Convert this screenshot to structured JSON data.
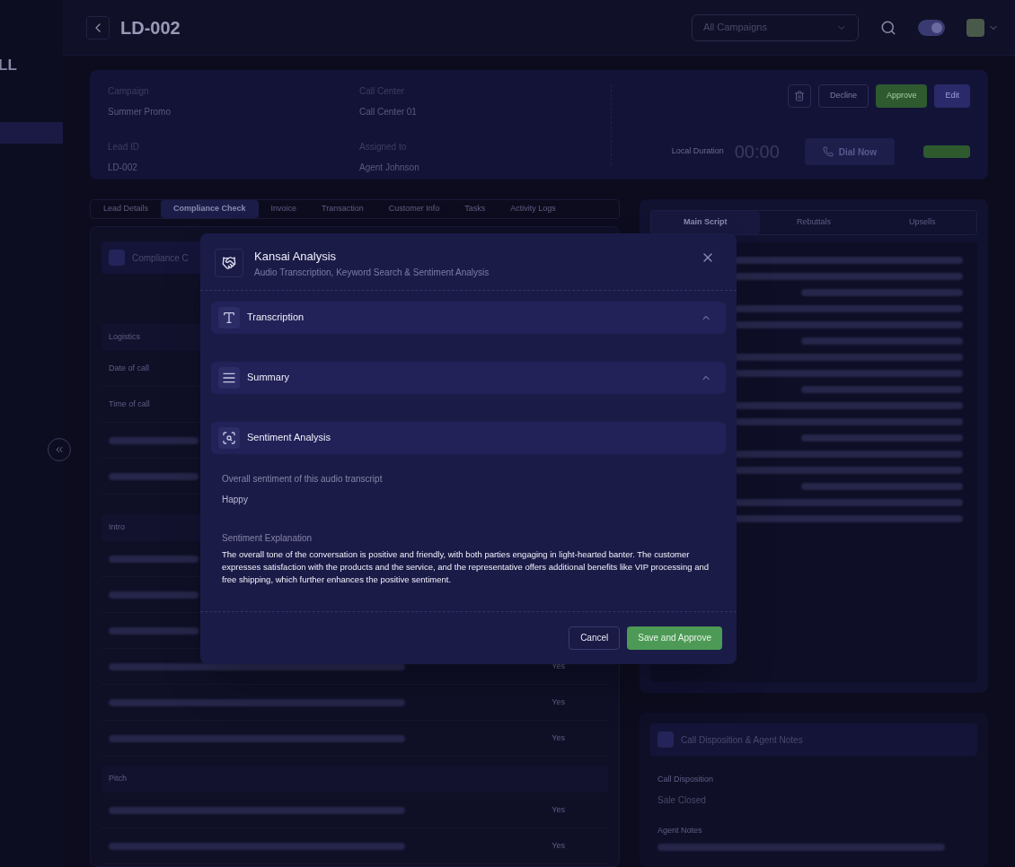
{
  "sidebar": {
    "logo_text": "LL"
  },
  "header": {
    "title": "LD-002",
    "campaign_select": {
      "value": "All Campaigns"
    },
    "theme_toggle": {
      "on": true
    }
  },
  "lead_card": {
    "fields": [
      {
        "label": "Campaign",
        "value": "Summer Promo"
      },
      {
        "label": "Call Center",
        "value": "Call Center 01"
      },
      {
        "label": "Lead ID",
        "value": "LD-002"
      },
      {
        "label": "Assigned to",
        "value": "Agent Johnson"
      }
    ],
    "actions": [
      {
        "label": "Decline",
        "kind": "outline"
      },
      {
        "label": "Approve",
        "kind": "success"
      },
      {
        "label": "Edit",
        "kind": "primary"
      }
    ],
    "duration_label": "Local Duration",
    "duration": "00:00",
    "dial_button": "Dial Now"
  },
  "tabs": [
    {
      "label": "Lead Details",
      "selected": false
    },
    {
      "label": "Compliance Check",
      "selected": true
    },
    {
      "label": "Invoice",
      "selected": false
    },
    {
      "label": "Transaction",
      "selected": false
    },
    {
      "label": "Customer Info",
      "selected": false
    },
    {
      "label": "Tasks",
      "selected": false
    },
    {
      "label": "Activity Logs",
      "selected": false
    }
  ],
  "compliance": {
    "title": "Compliance C",
    "sections": [
      {
        "title": "Logistics",
        "rows": [
          {
            "question": "Date of call"
          },
          {
            "question": "Time of call"
          },
          {
            "kind": "blurred"
          },
          {
            "kind": "blurred"
          }
        ]
      },
      {
        "title": "Intro",
        "rows": [
          {
            "kind": "blurred"
          },
          {
            "kind": "blurred"
          },
          {
            "kind": "blurred"
          },
          {
            "answer": "Yes"
          },
          {
            "answer": "Yes"
          },
          {
            "answer": "Yes"
          }
        ]
      },
      {
        "title": "Pitch",
        "rows": [
          {
            "answer": "Yes"
          },
          {
            "answer": "Yes"
          }
        ]
      }
    ]
  },
  "script_tabs": [
    {
      "label": "Main Script",
      "selected": true
    },
    {
      "label": "Rebuttals",
      "selected": false
    },
    {
      "label": "Upsells",
      "selected": false
    }
  ],
  "notes_card": {
    "title": "Call Disposition & Agent Notes",
    "fields": [
      {
        "label": "Call Disposition",
        "value": "Sale Closed"
      },
      {
        "label": "Agent Notes"
      }
    ]
  },
  "modal": {
    "title": "Kansai Analysis",
    "subtitle": "Audio Transcription, Keyword Search & Sentiment Analysis",
    "sections": [
      {
        "title": "Transcription",
        "kind": "text",
        "chevron": true
      },
      {
        "title": "Summary",
        "kind": "list",
        "chevron": true
      },
      {
        "title": "Sentiment Analysis",
        "kind": "sentiment",
        "chevron": false
      }
    ],
    "sentiment_label": "Overall sentiment of this audio transcript",
    "sentiment": "Happy",
    "explanation_label": "Sentiment Explanation",
    "explanation": "The overall tone of the conversation is positive and friendly, with both parties engaging in light-hearted banter. The customer expresses satisfaction with the products and the service, and the representative offers additional benefits like VIP processing and free shipping, which further enhances the positive sentiment.",
    "buttons": [
      {
        "label": "Cancel",
        "kind": "outline"
      },
      {
        "label": "Save and Approve",
        "kind": "success"
      }
    ]
  }
}
